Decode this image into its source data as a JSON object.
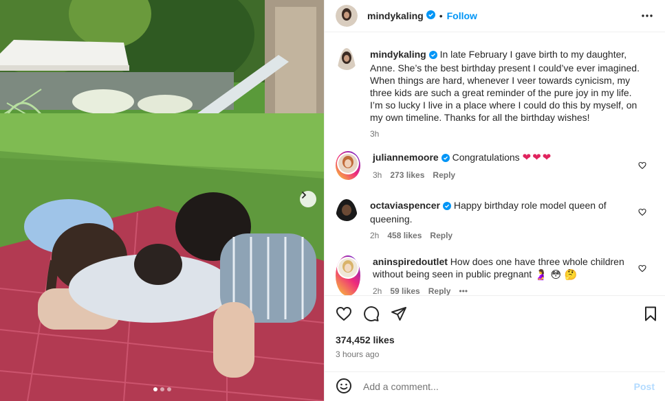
{
  "post": {
    "author": "mindykaling",
    "follow_label": "Follow",
    "separator": "•",
    "caption": "In late February I gave birth to my daughter, Anne. She’s the best birthday present I could’ve ever imagined. When things are hard, whenever I veer towards cynicism, my three kids are such a great reminder of the pure joy in my life. I’m so lucky I live in a place where I could do this by myself, on my own timeline. Thanks for all the birthday wishes!",
    "caption_age": "3h",
    "likes": "374,452 likes",
    "posted": "3 hours ago",
    "image_index": 1,
    "image_count": 3
  },
  "comments": [
    {
      "user": "juliannemoore",
      "verified": true,
      "text": "Congratulations",
      "emoji": "❤❤❤",
      "age": "3h",
      "likes": "273 likes",
      "reply": "Reply"
    },
    {
      "user": "octaviaspencer",
      "verified": true,
      "text": "Happy birthday role model queen of queening.",
      "emoji": "",
      "age": "2h",
      "likes": "458 likes",
      "reply": "Reply"
    },
    {
      "user": "aninspiredoutlet",
      "verified": false,
      "text": "How does one have three whole children without being seen in public pregnant",
      "emoji": "🤰 😳 🤔",
      "age": "2h",
      "likes": "59 likes",
      "reply": "Reply",
      "more": "•••"
    }
  ],
  "composer": {
    "placeholder": "Add a comment...",
    "post_label": "Post"
  },
  "colors": {
    "accent": "#0095f6",
    "verified": "#0095f6",
    "post_disabled": "#b3dbff",
    "heart": "#e0245e"
  },
  "icons": {
    "header_more": "more-horizontal-icon",
    "like": "heart-outline-icon",
    "comment": "comment-bubble-icon",
    "share": "paper-plane-icon",
    "save": "bookmark-icon",
    "emoji": "smiley-icon",
    "next": "chevron-right-icon",
    "verified": "verified-badge-icon"
  }
}
